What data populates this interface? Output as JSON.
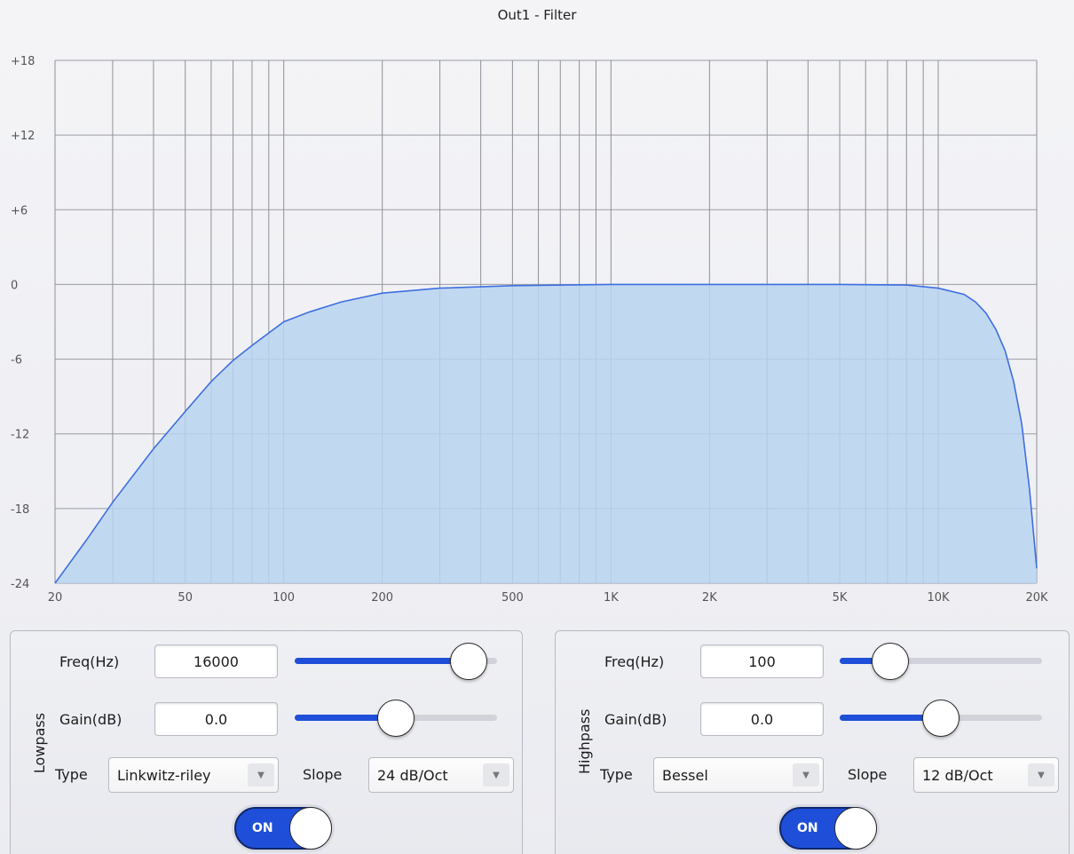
{
  "title": "Out1 - Filter",
  "chart_data": {
    "type": "area",
    "title": "Out1 - Filter",
    "x_scale": "log",
    "xlim": [
      20,
      20000
    ],
    "ylim": [
      -24,
      18
    ],
    "y_ticks": [
      18,
      12,
      6,
      0,
      -6,
      -12,
      -18,
      -24
    ],
    "y_tick_labels": [
      "+18",
      "+12",
      "+6",
      "0",
      "-6",
      "-12",
      "-18",
      "-24"
    ],
    "x_ticks": [
      20,
      50,
      100,
      200,
      500,
      1000,
      2000,
      5000,
      10000,
      20000
    ],
    "x_tick_labels": [
      "20",
      "50",
      "100",
      "200",
      "500",
      "1K",
      "2K",
      "5K",
      "10K",
      "20K"
    ],
    "grid": true,
    "series": [
      {
        "x": [
          20,
          25,
          30,
          40,
          50,
          60,
          70,
          80,
          100,
          120,
          150,
          200,
          300,
          500,
          1000,
          2000,
          5000,
          8000,
          10000,
          12000,
          13000,
          14000,
          15000,
          16000,
          17000,
          18000,
          19000,
          20000
        ],
        "y": [
          -24,
          -20.5,
          -17.5,
          -13.2,
          -10.2,
          -7.8,
          -6.1,
          -4.9,
          -3.0,
          -2.2,
          -1.4,
          -0.7,
          -0.3,
          -0.1,
          0,
          0,
          0,
          -0.05,
          -0.3,
          -0.8,
          -1.4,
          -2.3,
          -3.6,
          -5.3,
          -7.8,
          -11.2,
          -16.4,
          -22.8
        ]
      }
    ],
    "colors": {
      "line": "#3e6fe0",
      "fill": "#b9d3f0"
    }
  },
  "lowpass": {
    "label": "Lowpass",
    "freq_label": "Freq(Hz)",
    "freq_value": "16000",
    "freq_slider_fraction": 0.86,
    "gain_label": "Gain(dB)",
    "gain_value": "0.0",
    "gain_slider_fraction": 0.5,
    "type_label": "Type",
    "type_value": "Linkwitz-riley",
    "slope_label": "Slope",
    "slope_value": "24 dB/Oct",
    "toggle_label": "ON"
  },
  "highpass": {
    "label": "Highpass",
    "freq_label": "Freq(Hz)",
    "freq_value": "100",
    "freq_slider_fraction": 0.25,
    "gain_label": "Gain(dB)",
    "gain_value": "0.0",
    "gain_slider_fraction": 0.5,
    "type_label": "Type",
    "type_value": "Bessel",
    "slope_label": "Slope",
    "slope_value": "12 dB/Oct",
    "toggle_label": "ON"
  },
  "icons": {
    "dropdown": "chevron-down-icon"
  }
}
